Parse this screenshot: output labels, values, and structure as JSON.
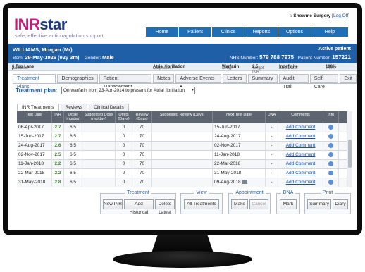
{
  "app": {
    "logo_inr": "INR",
    "logo_star": "star",
    "tagline": "safe, effective anticoagulation support",
    "surgery": "Showme Surgery",
    "logoff": "Log Off"
  },
  "nav": [
    "Home",
    "Patient",
    "Clinics",
    "Reports",
    "Options",
    "Help"
  ],
  "patient": {
    "name": "WILLIAMS, Morgan (Mr)",
    "born_label": "Born:",
    "born": "29-May-1926 (92y 3m)",
    "gender_label": "Gender:",
    "gender": "Male",
    "status": "Active patient",
    "nhs_label": "NHS Number:",
    "nhs": "579 788 7975",
    "patient_number_label": "Patient Number:",
    "patient_number": "157221",
    "address_label": "Address:",
    "address": "6 Top Lane",
    "diagnosis_label": "Diagnosis:",
    "diagnosis": "Atrial fibrillation",
    "drug_label": "Drug:",
    "drug": "Warfarin",
    "target_label": "Target INR:",
    "target": "2.5",
    "end_label": "End Date:",
    "end": "Indefinite",
    "ttr_label": "TTR:",
    "ttr": "100%"
  },
  "tabs": [
    "Treatment Plans",
    "Demographics",
    "Patient Management",
    "Notes",
    "Adverse Events",
    "Letters",
    "Summary",
    "Audit Trail",
    "Self-Care",
    "Exit"
  ],
  "treatment_plan": {
    "label": "Treatment plan:",
    "selected": "On warfarin from 23-Apr-2014 to present for Atrial fibrillation"
  },
  "subtabs": [
    "INR Treatments",
    "Reviews",
    "Clinical Details"
  ],
  "table": {
    "headers": [
      "Test Date",
      "INR",
      "Dose (mg/day)",
      "Suggested Dose (mg/day)",
      "Omits (Days)",
      "Review (Days)",
      "Suggested Review (Days)",
      "Next Test Date",
      "DNA",
      "Comments",
      "Info"
    ],
    "rows": [
      {
        "date": "06-Apr-2017",
        "inr": "2.7",
        "dose": "6.5",
        "sdose": "",
        "omits": "0",
        "review": "70",
        "sreview": "",
        "next": "15-Jun-2017",
        "dna": "-",
        "comment": "Add Comment"
      },
      {
        "date": "15-Jun-2017",
        "inr": "2.7",
        "dose": "6.5",
        "sdose": "",
        "omits": "0",
        "review": "70",
        "sreview": "",
        "next": "24-Aug-2017",
        "dna": "-",
        "comment": "Add Comment"
      },
      {
        "date": "24-Aug-2017",
        "inr": "2.6",
        "dose": "6.5",
        "sdose": "",
        "omits": "0",
        "review": "70",
        "sreview": "",
        "next": "02-Nov-2017",
        "dna": "-",
        "comment": "Add Comment"
      },
      {
        "date": "02-Nov-2017",
        "inr": "2.5",
        "dose": "6.5",
        "sdose": "",
        "omits": "0",
        "review": "70",
        "sreview": "",
        "next": "11-Jan-2018",
        "dna": "-",
        "comment": "Add Comment"
      },
      {
        "date": "11-Jan-2018",
        "inr": "2.2",
        "dose": "6.5",
        "sdose": "",
        "omits": "0",
        "review": "70",
        "sreview": "",
        "next": "22-Mar-2018",
        "dna": "-",
        "comment": "Add Comment"
      },
      {
        "date": "22-Mar-2018",
        "inr": "2.2",
        "dose": "6.5",
        "sdose": "",
        "omits": "0",
        "review": "70",
        "sreview": "",
        "next": "31-May-2018",
        "dna": "-",
        "comment": "Add Comment"
      },
      {
        "date": "31-May-2018",
        "inr": "2.8",
        "dose": "6.5",
        "sdose": "",
        "omits": "0",
        "review": "70",
        "sreview": "",
        "next": "09-Aug-2018",
        "dna": "-",
        "comment": "Add Comment"
      }
    ]
  },
  "actions": {
    "treatment": {
      "title": "Treatment",
      "buttons": [
        "New INR",
        "Add Historical",
        "Delete Latest"
      ]
    },
    "view": {
      "title": "View",
      "buttons": [
        "All Treatments"
      ]
    },
    "appointment": {
      "title": "Appointment",
      "buttons": [
        "Make",
        "Cancel"
      ]
    },
    "dna": {
      "title": "DNA",
      "buttons": [
        "Mark"
      ]
    },
    "print": {
      "title": "Print",
      "buttons": [
        "Summary",
        "Diary"
      ]
    }
  },
  "colors": {
    "brand_blue": "#1f5fa8",
    "brand_pink": "#c61a7b",
    "inr_green": "#3a8a2a"
  }
}
